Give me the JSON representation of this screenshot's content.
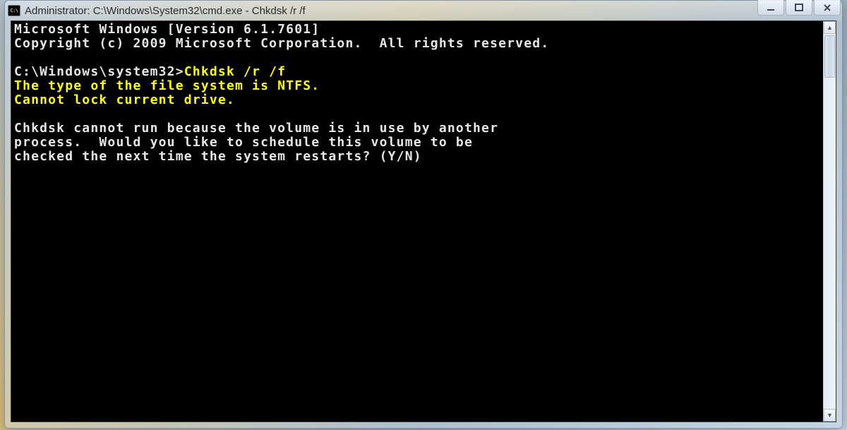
{
  "window": {
    "icon_label": "C:\\",
    "title": "Administrator: C:\\Windows\\System32\\cmd.exe - Chkdsk  /r /f"
  },
  "terminal": {
    "header_line1": "Microsoft Windows [Version 6.1.7601]",
    "header_line2": "Copyright (c) 2009 Microsoft Corporation.  All rights reserved.",
    "prompt": "C:\\Windows\\system32>",
    "command": "Chkdsk /r /f",
    "result_line1": "The type of the file system is NTFS.",
    "result_line2": "Cannot lock current drive.",
    "message_line1": "Chkdsk cannot run because the volume is in use by another",
    "message_line2": "process.  Would you like to schedule this volume to be",
    "message_line3": "checked the next time the system restarts? (Y/N)"
  }
}
